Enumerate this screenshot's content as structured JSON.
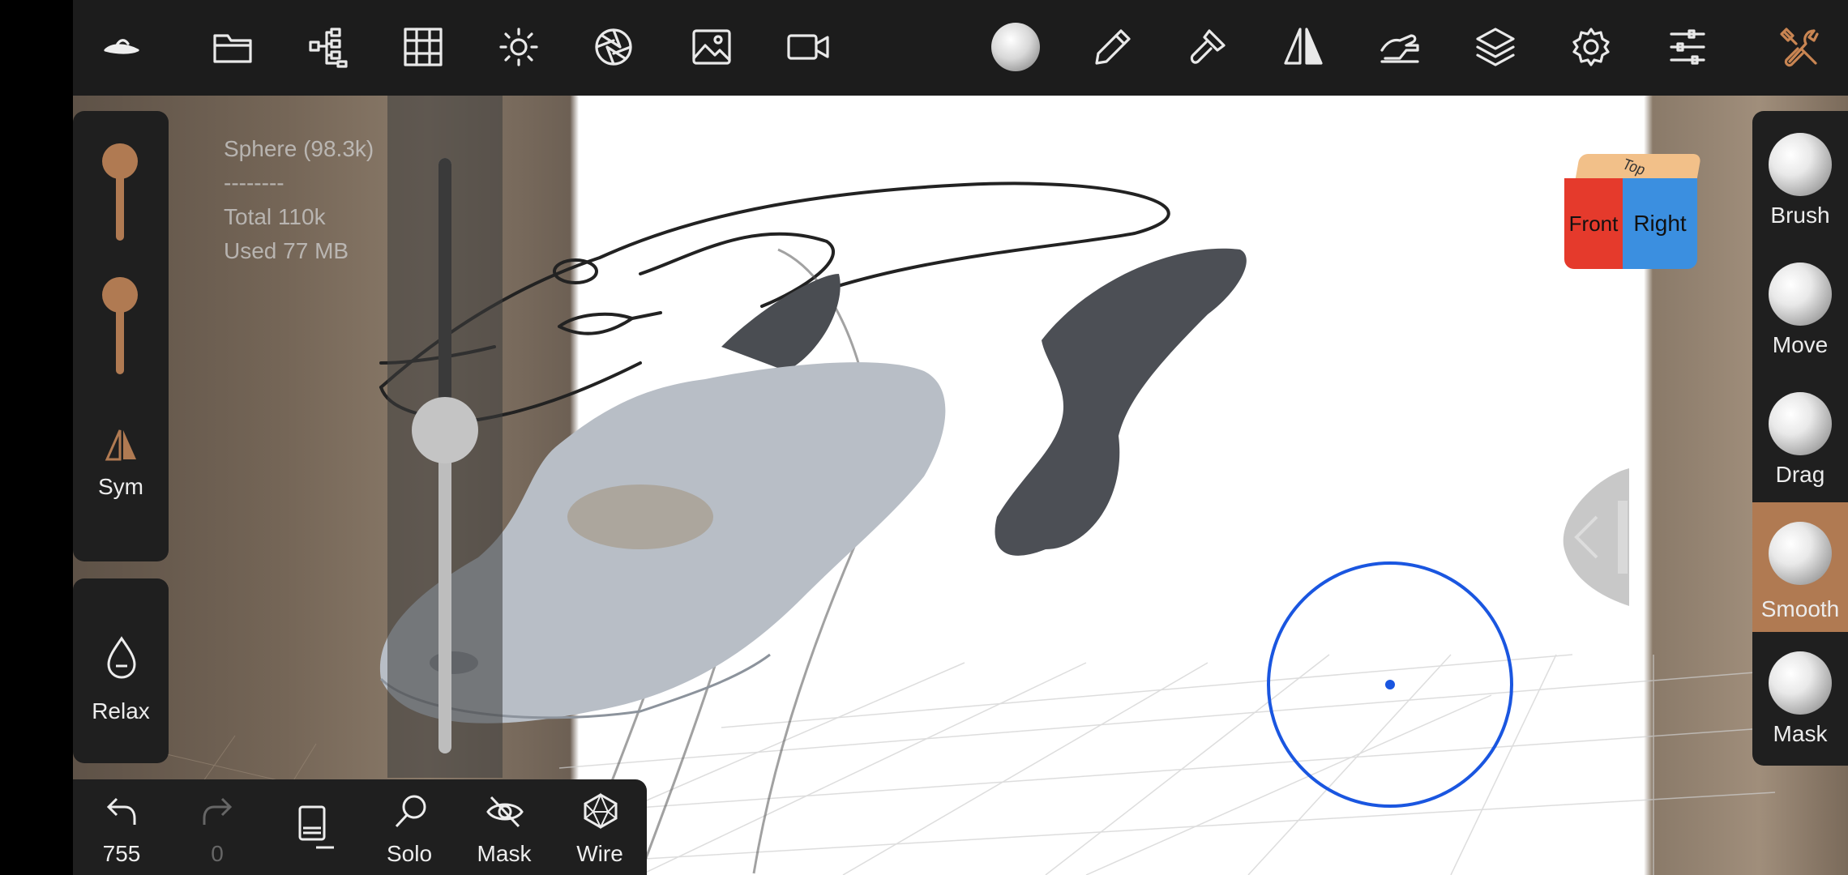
{
  "toolbar_icons": [
    "logo-icon",
    "folder-icon",
    "scene-tree-icon",
    "grid-icon",
    "light-icon",
    "aperture-icon",
    "image-icon",
    "video-icon",
    "material-sphere-icon",
    "pen-icon",
    "paint-brush-icon",
    "symmetry-icon",
    "hand-icon",
    "layers-icon",
    "settings-icon",
    "sliders-icon",
    "tools-icon"
  ],
  "stats": {
    "mesh": "Sphere (98.3k)",
    "separator": "--------",
    "total": "Total 110k",
    "used": "Used 77 MB"
  },
  "left_panel": {
    "sym_label": "Sym",
    "relax_label": "Relax"
  },
  "view_cube": {
    "top": "Top",
    "front": "Front",
    "right": "Right"
  },
  "brushes": [
    {
      "label": "Brush",
      "active": false
    },
    {
      "label": "Move",
      "active": false
    },
    {
      "label": "Drag",
      "active": false
    },
    {
      "label": "Smooth",
      "active": true
    },
    {
      "label": "Mask",
      "active": false
    }
  ],
  "bottom": {
    "undo_count": "755",
    "redo_count": "0",
    "solo_label": "Solo",
    "mask_label": "Mask",
    "wire_label": "Wire"
  },
  "colors": {
    "accent": "#b07a52",
    "cursor": "#1a56e0",
    "cube_front": "#e53a2c",
    "cube_right": "#3b8fe0",
    "cube_top": "#f2c089"
  }
}
